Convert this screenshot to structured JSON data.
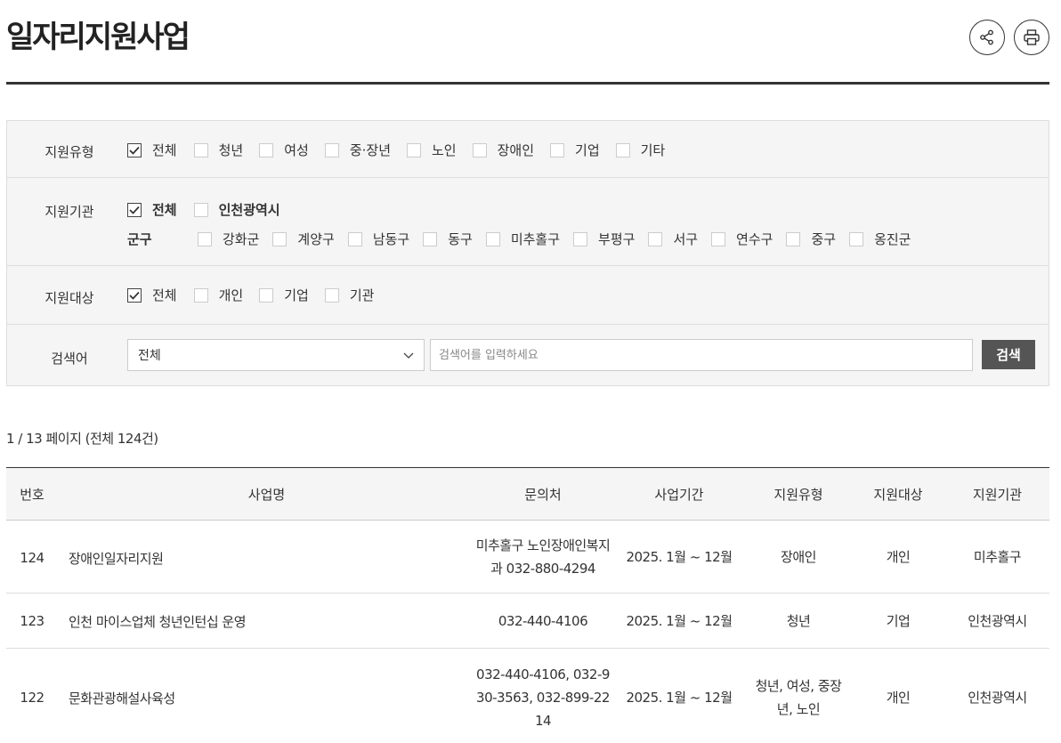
{
  "page": {
    "title": "일자리지원사업"
  },
  "icons": {
    "share": "share-icon",
    "print": "print-icon",
    "checkmark": "check-icon",
    "dropdown": "chevron-down-icon"
  },
  "filters": {
    "support_type": {
      "label": "지원유형",
      "options": [
        {
          "label": "전체",
          "checked": true
        },
        {
          "label": "청년",
          "checked": false
        },
        {
          "label": "여성",
          "checked": false
        },
        {
          "label": "중·장년",
          "checked": false
        },
        {
          "label": "노인",
          "checked": false
        },
        {
          "label": "장애인",
          "checked": false
        },
        {
          "label": "기업",
          "checked": false
        },
        {
          "label": "기타",
          "checked": false
        }
      ]
    },
    "support_org": {
      "label": "지원기관",
      "options": [
        {
          "label": "전체",
          "checked": true
        },
        {
          "label": "인천광역시",
          "checked": false
        }
      ],
      "district_label": "군구",
      "districts": [
        {
          "label": "강화군",
          "checked": false
        },
        {
          "label": "계양구",
          "checked": false
        },
        {
          "label": "남동구",
          "checked": false
        },
        {
          "label": "동구",
          "checked": false
        },
        {
          "label": "미추홀구",
          "checked": false
        },
        {
          "label": "부평구",
          "checked": false
        },
        {
          "label": "서구",
          "checked": false
        },
        {
          "label": "연수구",
          "checked": false
        },
        {
          "label": "중구",
          "checked": false
        },
        {
          "label": "옹진군",
          "checked": false
        }
      ]
    },
    "support_target": {
      "label": "지원대상",
      "options": [
        {
          "label": "전체",
          "checked": true
        },
        {
          "label": "개인",
          "checked": false
        },
        {
          "label": "기업",
          "checked": false
        },
        {
          "label": "기관",
          "checked": false
        }
      ]
    },
    "search": {
      "label": "검색어",
      "select_value": "전체",
      "placeholder": "검색어를 입력하세요",
      "button": "검색"
    }
  },
  "page_info": "1 / 13 페이지 (전체 124건)",
  "table": {
    "headers": {
      "no": "번호",
      "name": "사업명",
      "contact": "문의처",
      "period": "사업기간",
      "type": "지원유형",
      "target": "지원대상",
      "org": "지원기관"
    },
    "rows": [
      {
        "no": "124",
        "name": "장애인일자리지원",
        "contact": "미추홀구 노인장애인복지과 032-880-4294",
        "period": "2025. 1월 ~ 12월",
        "type": "장애인",
        "target": "개인",
        "org": "미추홀구"
      },
      {
        "no": "123",
        "name": "인천 마이스업체 청년인턴십 운영",
        "contact": "032-440-4106",
        "period": "2025. 1월 ~ 12월",
        "type": "청년",
        "target": "기업",
        "org": "인천광역시"
      },
      {
        "no": "122",
        "name": "문화관광해설사육성",
        "contact": "032-440-4106, 032-930-3563, 032-899-2214",
        "period": "2025. 1월 ~ 12월",
        "type": "청년, 여성, 중장년, 노인",
        "target": "개인",
        "org": "인천광역시"
      }
    ]
  }
}
